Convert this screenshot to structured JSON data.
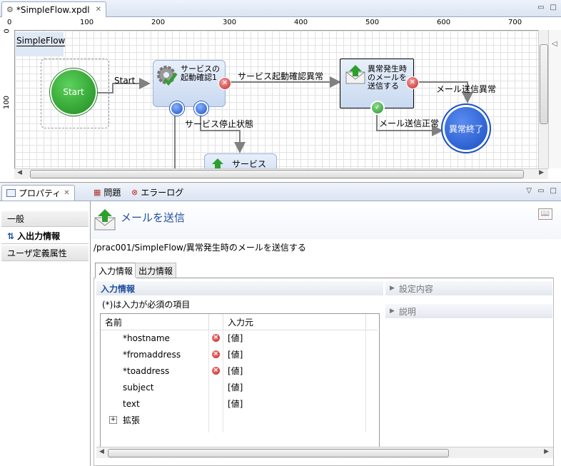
{
  "editor": {
    "tab_title": "*SimpleFlow.xpdl",
    "ruler_top": [
      "0",
      "100",
      "200",
      "300",
      "400",
      "500",
      "600",
      "700"
    ],
    "ruler_left": [
      "0",
      "100"
    ],
    "pool_label": "SimpleFlow",
    "nodes": {
      "start": "Start",
      "service_check": "サービスの起動確認1",
      "mail_error": "異常発生時のメールを送信する",
      "abnormal_end": "異常終了",
      "service_partial": "サービス"
    },
    "edges": {
      "start": "Start",
      "service_check_error": "サービス起動確認異常",
      "service_stop": "サービス停止状態",
      "mail_send_error": "メール送信異常",
      "mail_send_ok": "メール送信正常"
    }
  },
  "panel": {
    "tabs": [
      "プロパティ",
      "問題",
      "エラーログ"
    ],
    "side_items": [
      "一般",
      "入出力情報",
      "ユーザ定義属性"
    ],
    "title": "メールを送信",
    "path": "/prac001/SimpleFlow/異常発生時のメールを送信する",
    "subtabs": [
      "入力情報",
      "出力情報"
    ],
    "section_title": "入力情報",
    "required_note": "(*)は入力が必須の項目",
    "columns": [
      "名前",
      "入力元"
    ],
    "rows": [
      {
        "name": "*hostname",
        "source": "[値]",
        "error": true
      },
      {
        "name": "*fromaddress",
        "source": "[値]",
        "error": true
      },
      {
        "name": "*toaddress",
        "source": "[値]",
        "error": true
      },
      {
        "name": "subject",
        "source": "[値]",
        "error": false
      },
      {
        "name": "text",
        "source": "[値]",
        "error": false
      }
    ],
    "expand_row": {
      "symbol": "+",
      "label": "拡張"
    },
    "right_sections": [
      "設定内容",
      "説明"
    ]
  },
  "colors": {
    "accent": "#1f4e9e",
    "start_green": "#1e8c1e",
    "end_blue": "#1a4fc4",
    "error_red": "#c62828"
  }
}
